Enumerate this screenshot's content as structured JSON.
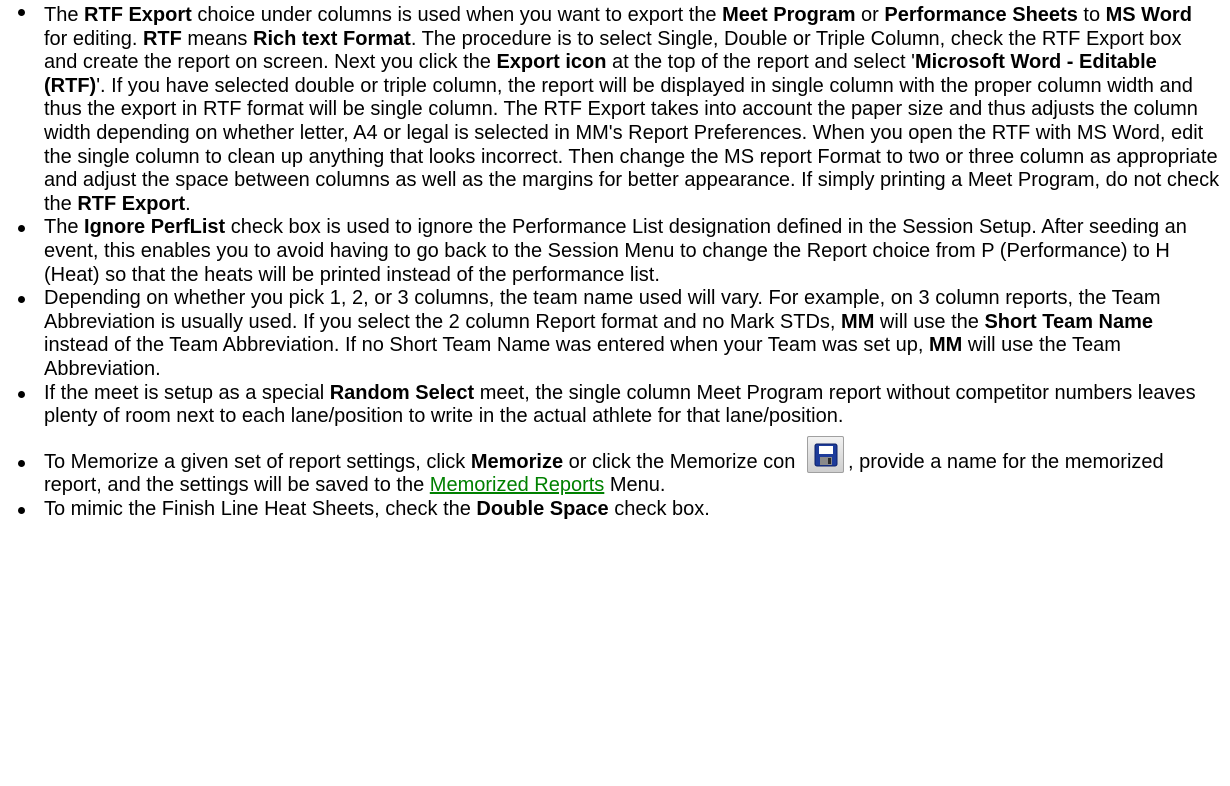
{
  "bullets": {
    "rtf": [
      "The ",
      "RTF Export",
      " choice under columns is used when you want to export the ",
      "Meet Program",
      " or ",
      "Performance Sheets",
      " to ",
      "MS Word",
      " for editing. ",
      "RTF",
      " means ",
      "Rich text Format",
      ". The procedure is to select Single, Double or Triple Column, check the RTF Export box and create the report on screen. Next you click the ",
      "Export icon",
      " at the top of the report and select '",
      "Microsoft Word - Editable (RTF)",
      "'. If you have selected double or triple column, the report will be displayed in single column with the proper column width and thus the export in RTF format will be single column. The RTF Export takes into account the paper size and thus adjusts the column width depending on whether letter, A4 or legal is selected in MM's Report Preferences. When you open the RTF with MS Word, edit the single column to clean up anything that looks incorrect. Then change the MS report Format to two or three column as appropriate and adjust the space between columns as well as the margins for better appearance. If simply printing a Meet Program, do not check the ",
      "RTF Export",
      "."
    ],
    "perflist": [
      "The ",
      "Ignore PerfList",
      " check box is used to ignore the Performance List designation defined in the Session Setup. After seeding an event, this enables you to avoid having to go back to the Session Menu to change the Report choice from P (Performance) to H (Heat) so that the heats will be printed instead of the performance list."
    ],
    "columns": [
      "Depending on whether you pick 1, 2, or 3 columns, the team name used will vary. For example, on 3 column reports, the Team Abbreviation is usually used. If you select the 2 column Report format and no Mark STDs, ",
      "MM",
      " will use the ",
      "Short Team Name",
      " instead of the Team Abbreviation.  If no Short Team Name was entered when your Team was set up, ",
      "MM",
      " will use the Team Abbreviation."
    ],
    "random": [
      "If the meet is setup as a special ",
      "Random Select",
      " meet, the single column Meet Program report without competitor numbers leaves plenty of room next to each lane/position to write in the actual athlete for that lane/position."
    ],
    "memorize": [
      "To Memorize a given set of report settings, click ",
      "Memorize",
      " or click the Memorize con ",
      ", provide a name for the memorized report, and the settings will be saved to the ",
      "Memorized Reports",
      " Menu."
    ],
    "double_space": [
      "To mimic the Finish Line Heat Sheets, check the ",
      "Double Space",
      " check box."
    ]
  },
  "memorize_icon": "floppy-disk-save-icon",
  "link_color": "#008000"
}
